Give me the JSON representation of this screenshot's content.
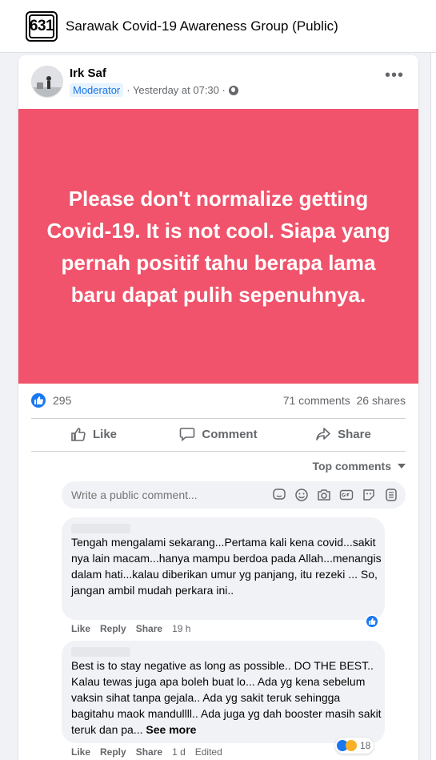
{
  "header": {
    "group_icon_text": "631",
    "group_name": "Sarawak Covid-19 Awareness Group (Public)"
  },
  "post": {
    "author": "Irk Saf",
    "role_badge": "Moderator",
    "timestamp": "· Yesterday at 07:30 ·",
    "more_icon": "•••",
    "banner_text": "Please don't normalize getting Covid-19. It is not cool. Siapa yang pernah positif tahu berapa lama baru dapat pulih sepenuhnya.",
    "banner_color": "#f0536b",
    "reactions_count": "295",
    "comments_shares": "71 comments  26 shares"
  },
  "actions": {
    "like": "Like",
    "comment": "Comment",
    "share": "Share"
  },
  "comments_section": {
    "sort_label": "Top comments",
    "composer_placeholder": "Write a public comment..."
  },
  "comments": [
    {
      "text": "Tengah mengalami sekarang...Pertama kali kena covid...sakit nya lain macam...hanya mampu berdoa pada Allah...menangis dalam hati...kalau diberikan umur yg panjang, itu rezeki ... So, jangan ambil mudah perkara ini..",
      "like": "Like",
      "reply": "Reply",
      "share": "Share",
      "time": "19 h"
    },
    {
      "text": "Best is to stay negative as long as possible.. DO THE BEST.. Kalau tewas juga apa boleh buat lo... Ada yg kena sebelum vaksin sihat tanpa gejala.. Ada yg sakit teruk sehingga bagitahu maok mandullll.. Ada juga yg dah booster masih sakit teruk dan pa...",
      "see_more": "See more",
      "like": "Like",
      "reply": "Reply",
      "share": "Share",
      "time": "1 d",
      "edited": "Edited",
      "reaction_count": "18"
    }
  ]
}
